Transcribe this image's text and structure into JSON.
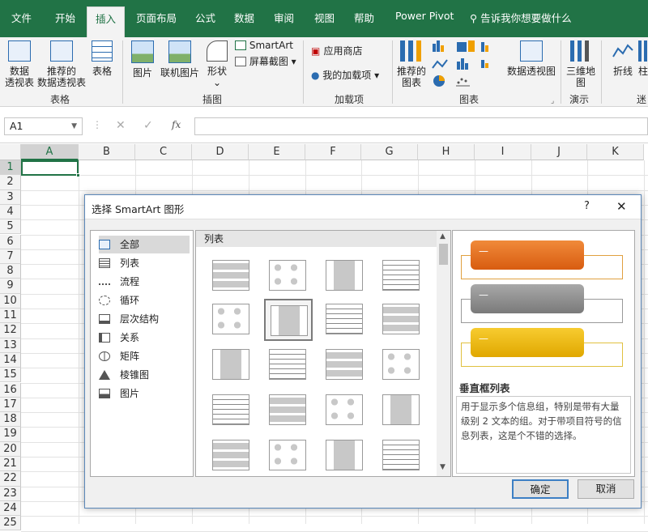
{
  "ribbon_tabs": [
    "文件",
    "开始",
    "插入",
    "页面布局",
    "公式",
    "数据",
    "审阅",
    "视图",
    "帮助",
    "Power Pivot"
  ],
  "tell_me": "告诉我你想要做什么",
  "groups": {
    "tables": {
      "label": "表格",
      "buttons": [
        "数据\n透视表",
        "推荐的\n数据透视表",
        "表格"
      ]
    },
    "illustrations": {
      "label": "插图",
      "buttons": [
        "图片",
        "联机图片",
        "形状\n⌄"
      ],
      "smartart": "SmartArt",
      "screenshot": "屏幕截图"
    },
    "addins": {
      "label": "加载项",
      "store": "应用商店",
      "my_addins": "我的加载项"
    },
    "charts": {
      "label": "图表",
      "recommended": "推荐的\n图表",
      "pivotchart": "数据透视图"
    },
    "tours": {
      "label": "演示",
      "map3d": "三维地\n图"
    },
    "sparklines": {
      "label": "迷",
      "line": "折线",
      "col": "柱"
    }
  },
  "name_box": "A1",
  "fx": "fx",
  "columns": [
    "A",
    "B",
    "C",
    "D",
    "E",
    "F",
    "G",
    "H",
    "I",
    "J",
    "K"
  ],
  "rows": [
    "1",
    "2",
    "3",
    "4",
    "5",
    "6",
    "7",
    "8",
    "9",
    "10",
    "11",
    "12",
    "13",
    "14",
    "15",
    "16",
    "17",
    "18",
    "19",
    "20",
    "21",
    "22",
    "23",
    "24",
    "25"
  ],
  "dialog": {
    "title": "选择 SmartArt 图形",
    "help": "?",
    "categories": [
      "全部",
      "列表",
      "流程",
      "循环",
      "层次结构",
      "关系",
      "矩阵",
      "棱锥图",
      "图片"
    ],
    "gallery_header": "列表",
    "preview_title": "垂直框列表",
    "preview_desc": "用于显示多个信息组，特别是带有大量级别 2 文本的组。对于带项目符号的信息列表，这是个不错的选择。",
    "bullet": "—",
    "ok": "确定",
    "cancel": "取消"
  },
  "colors": {
    "excel_green": "#217346",
    "orange": "#e36c25",
    "gray": "#8c8c8c",
    "gold": "#f0b400"
  }
}
